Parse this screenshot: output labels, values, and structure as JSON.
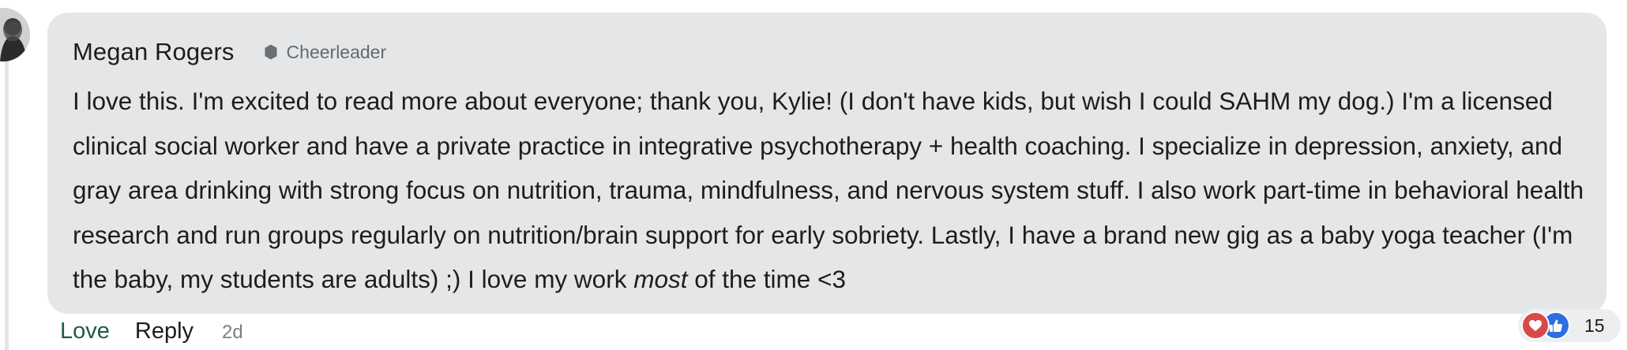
{
  "comment": {
    "author": "Megan Rogers",
    "badge": "Cheerleader",
    "text_segments": {
      "before": "I love this. I'm excited to read more about everyone; thank you, Kylie! (I don't have kids, but wish I could SAHM my dog.) I'm a licensed clinical social worker and have a private practice in integrative psychotherapy + health coaching. I specialize in depression, anxiety, and gray area drinking with strong focus on nutrition, trauma, mindfulness, and nervous system stuff. I also work part-time in behavioral health research and run groups regularly on nutrition/brain support for early sobriety. Lastly, I have a brand new gig as a baby yoga teacher (I'm the baby, my students are adults) ;) I love my work ",
      "emphasis": "most",
      "after": " of the time <3"
    }
  },
  "actions": {
    "love_label": "Love",
    "reply_label": "Reply",
    "timestamp": "2d"
  },
  "reactions": {
    "icons": [
      "heart-icon",
      "thumbs-up-icon"
    ],
    "count": "15"
  },
  "colors": {
    "bubble_bg": "#e4e6e7",
    "love_green": "#1f5c47",
    "heart_red": "#d84a4a",
    "like_blue": "#2f6ee0",
    "badge_gray": "#666a6d"
  }
}
